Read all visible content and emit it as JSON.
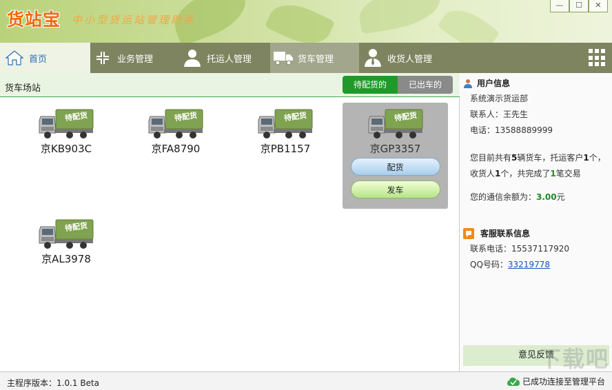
{
  "app": {
    "logo": "货站宝",
    "slogan": "中小型货运站管理助手"
  },
  "window": {
    "minimize": "—",
    "maximize": "☐",
    "close": "✕"
  },
  "nav": {
    "items": [
      {
        "label": "首页",
        "icon": "home-icon"
      },
      {
        "label": "业务管理",
        "icon": "arrows-collapse-icon"
      },
      {
        "label": "托运人管理",
        "icon": "person-icon"
      },
      {
        "label": "货车管理",
        "icon": "truck-icon"
      },
      {
        "label": "收货人管理",
        "icon": "person-tie-icon"
      }
    ],
    "grid_icon": "grid-menu-icon"
  },
  "station": {
    "title": "货车场站",
    "tab_pending": "待配货的",
    "tab_departed": "已出车的"
  },
  "trucks": [
    {
      "plate": "京KB903C",
      "badge": "待配货"
    },
    {
      "plate": "京FA8790",
      "badge": "待配货"
    },
    {
      "plate": "京PB1157",
      "badge": "待配货"
    },
    {
      "plate": "京GP3357",
      "badge": "待配货"
    },
    {
      "plate": "京AL3978",
      "badge": "待配货"
    }
  ],
  "selected_actions": {
    "assign": "配货",
    "depart": "发车"
  },
  "user_info": {
    "header": "用户信息",
    "department": "系统演示货运部",
    "contact_label": "联系人：",
    "contact": "王先生",
    "phone_label": "电话：",
    "phone": "13588889999",
    "summary_prefix": "您目前共有",
    "truck_count": "5",
    "summary_mid1": "辆货车，托运客户",
    "shipper_count": "1",
    "summary_mid2": "个，",
    "summary_mid3": "收货人",
    "consignee_count": "1",
    "summary_mid4": "个，共完成了",
    "deal_count": "1",
    "summary_suffix": "笔交易",
    "balance_label": "您的通信余额为：",
    "balance": "3.00",
    "balance_unit": "元"
  },
  "service_info": {
    "header": "客服联系信息",
    "phone_label": "联系电话：",
    "phone": "15537117920",
    "qq_label": "QQ号码：",
    "qq": "33219778"
  },
  "feedback": "意见反馈",
  "status": {
    "version_label": "主程序版本：",
    "version": "1.0.1 Beta",
    "connection": "已成功连接至管理平台"
  },
  "watermark": "下载吧"
}
